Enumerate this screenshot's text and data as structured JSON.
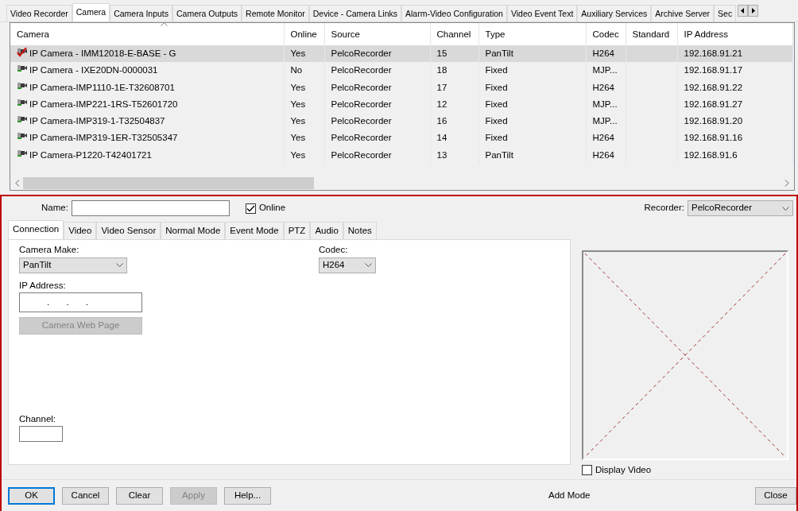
{
  "main_tabs": [
    {
      "label": "Video Recorder",
      "selected": false
    },
    {
      "label": "Camera",
      "selected": true
    },
    {
      "label": "Camera Inputs",
      "selected": false
    },
    {
      "label": "Camera Outputs",
      "selected": false
    },
    {
      "label": "Remote Monitor",
      "selected": false
    },
    {
      "label": "Device - Camera Links",
      "selected": false
    },
    {
      "label": "Alarm-Video Configuration",
      "selected": false
    },
    {
      "label": "Video Event Text",
      "selected": false
    },
    {
      "label": "Auxiliary Services",
      "selected": false
    },
    {
      "label": "Archive Server",
      "selected": false
    },
    {
      "label": "Sec",
      "selected": false
    }
  ],
  "table": {
    "columns": [
      {
        "label": "Camera",
        "sorted": true
      },
      {
        "label": "Online",
        "sorted": false
      },
      {
        "label": "Source",
        "sorted": false
      },
      {
        "label": "Channel",
        "sorted": false
      },
      {
        "label": "Type",
        "sorted": false
      },
      {
        "label": "Codec",
        "sorted": false
      },
      {
        "label": "Standard",
        "sorted": false
      },
      {
        "label": "IP Address",
        "sorted": false
      }
    ],
    "rows": [
      {
        "selected": true,
        "marked": true,
        "cells": [
          "IP Camera - IMM12018-E-BASE - G",
          "Yes",
          "PelcoRecorder",
          "15",
          "PanTilt",
          "H264",
          "",
          "192.168.91.21"
        ]
      },
      {
        "selected": false,
        "marked": false,
        "cells": [
          "IP Camera - IXE20DN-0000031",
          "No",
          "PelcoRecorder",
          "18",
          "Fixed",
          "MJP...",
          "",
          "192.168.91.17"
        ]
      },
      {
        "selected": false,
        "marked": false,
        "cells": [
          "IP Camera-IMP1110-1E-T32608701",
          "Yes",
          "PelcoRecorder",
          "17",
          "Fixed",
          "H264",
          "",
          "192.168.91.22"
        ]
      },
      {
        "selected": false,
        "marked": false,
        "cells": [
          "IP Camera-IMP221-1RS-T52601720",
          "Yes",
          "PelcoRecorder",
          "12",
          "Fixed",
          "MJP...",
          "",
          "192.168.91.27"
        ]
      },
      {
        "selected": false,
        "marked": false,
        "cells": [
          "IP Camera-IMP319-1-T32504837",
          "Yes",
          "PelcoRecorder",
          "16",
          "Fixed",
          "MJP...",
          "",
          "192.168.91.20"
        ]
      },
      {
        "selected": false,
        "marked": false,
        "cells": [
          "IP Camera-IMP319-1ER-T32505347",
          "Yes",
          "PelcoRecorder",
          "14",
          "Fixed",
          "H264",
          "",
          "192.168.91.16"
        ]
      },
      {
        "selected": false,
        "marked": false,
        "cells": [
          "IP Camera-P1220-T42401721",
          "Yes",
          "PelcoRecorder",
          "13",
          "PanTilt",
          "H264",
          "",
          "192.168.91.6"
        ]
      }
    ]
  },
  "form": {
    "name_label": "Name:",
    "online": {
      "label": "Online",
      "checked": true
    },
    "recorder_label": "Recorder:",
    "recorder": "PelcoRecorder",
    "tabs": [
      {
        "label": "Connection",
        "selected": true
      },
      {
        "label": "Video",
        "selected": false
      },
      {
        "label": "Video Sensor",
        "selected": false
      },
      {
        "label": "Normal Mode",
        "selected": false
      },
      {
        "label": "Event Mode",
        "selected": false
      },
      {
        "label": "PTZ",
        "selected": false
      },
      {
        "label": "Audio",
        "selected": false
      },
      {
        "label": "Notes",
        "selected": false
      }
    ],
    "camera_make_label": "Camera Make:",
    "camera_make": "PanTilt",
    "codec_label": "Codec:",
    "codec": "H264",
    "ip_label": "IP Address:",
    "ip_value": ". . .",
    "web_page_button": {
      "label": "Camera Web Page",
      "disabled": true
    },
    "channel_label": "Channel:",
    "display_video": {
      "label": "Display Video",
      "checked": false
    }
  },
  "buttons": [
    {
      "label": "OK",
      "disabled": false,
      "default": true
    },
    {
      "label": "Cancel",
      "disabled": false,
      "default": false
    },
    {
      "label": "Clear",
      "disabled": false,
      "default": false
    },
    {
      "label": "Apply",
      "disabled": true,
      "default": false
    },
    {
      "label": "Help...",
      "disabled": false,
      "default": false
    }
  ],
  "status": "Add Mode",
  "close_button": "Close"
}
